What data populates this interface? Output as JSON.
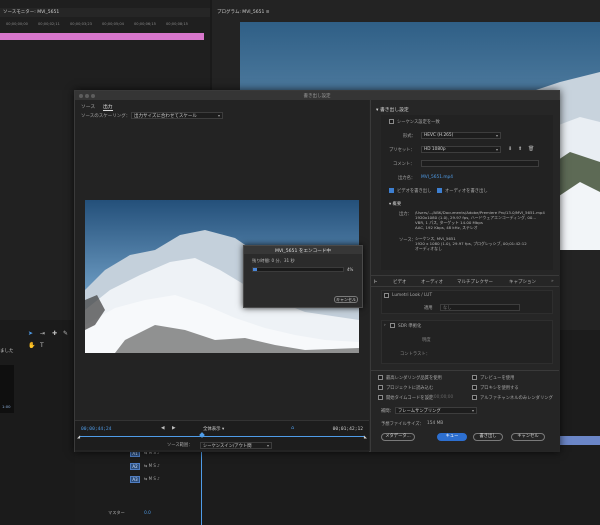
{
  "background": {
    "left_panel_title": "ソースモニター: MVI_5651",
    "left_timecodes": [
      "00;00;00;00",
      "00;00;02;11",
      "00;00;03;23",
      "00;00;05;04",
      "00;00;06;15",
      "00;00;08;15"
    ],
    "program_tab_title": "プログラム: MVI_5651 ≡",
    "left_partial_text": "ました",
    "left_partial_code": "1:00",
    "tracks": [
      {
        "label": "A1",
        "icons": "⇆  M  S  ♪"
      },
      {
        "label": "A2",
        "icons": "⇆  M  S  ♪"
      },
      {
        "label": "A3",
        "icons": "⇆  M  S  ♪"
      }
    ],
    "master_label": "マスター",
    "master_value": "0.0"
  },
  "dialog": {
    "title": "書き出し設定",
    "tabs": [
      "ソース",
      "出力"
    ],
    "active_tab": 1,
    "scaling_label": "ソースのスケーリング：",
    "scaling_value": "出力サイズに合わせてスケール",
    "encoding": {
      "title": "MVI_5651 をエンコード中",
      "remaining": "残り時間: 0 分、31 秒",
      "percent_label": "4%",
      "progress": 0.04,
      "cancel_label": "キャンセル"
    },
    "playback": {
      "current_tc": "00;00;44;24",
      "end_tc": "00;01;42;12",
      "zoom_value": "全体表示",
      "source_range_label": "ソース範囲：",
      "source_range_value": "シーケンスイン/アウト間"
    },
    "export_settings": {
      "header": "書き出し設定",
      "match_sequence_label": "シーケンス設定を一致",
      "format_label": "形式：",
      "format_value": "HEVC (H.265)",
      "preset_label": "プリセット：",
      "preset_value": "HD 1080p",
      "comment_label": "コメント：",
      "output_name_label": "出力名：",
      "output_name_value": "MVI_5651.mp4",
      "export_video_label": "ビデオを書き出し",
      "export_audio_label": "オーディオを書き出し",
      "summary_header": "概要",
      "output_label": "出力：",
      "output_lines": [
        "/Users/.../ABK/Documents/Adobe/Premiere Pro/13.0/MVI_5651.mp4",
        "1920x1080 (1.0), 29.97 fps, ハードウェアエンコーディング, 00...",
        "VBR, 1 パス, ターゲット 14.00 Mbps",
        "AAC, 192 Kbps, 48 kHz, ステレオ"
      ],
      "source_label": "ソース：",
      "source_lines": [
        "シーケンス, MVI_5651",
        "1920 x 1080 (1.0), 29.97 fps, プログレッシブ, 00;01:42:12",
        "オーディオなし"
      ]
    },
    "subtabs": [
      "ト",
      "ビデオ",
      "オーディオ",
      "マルチプレクサー",
      "キャプション"
    ],
    "lut_label": "Lumetri Look / LUT",
    "apply_label": "適用",
    "apply_value": "なし",
    "sdr_label": "SDR 準拠化",
    "brightness_label": "明度",
    "contrast_label": "コントラスト：",
    "options": {
      "max_render_label": "最高レンダリング品質を使用",
      "use_preview_label": "プレビューを使用",
      "import_project_label": "プロジェクトに読み込む",
      "use_proxy_label": "プロキシを使用する",
      "set_timecode_label": "開始タイムコードを設定",
      "timecode_value": "00;00;00;00",
      "render_alpha_label": "アルファチャンネルのみレンダリング",
      "interpolation_label": "補間：",
      "interpolation_value": "フレームサンプリング",
      "file_size_label": "予想ファイルサイズ：",
      "file_size_value": "154 MB"
    },
    "buttons": {
      "metadata": "メタデータ...",
      "queue": "キュー",
      "export": "書き出し",
      "cancel": "キャンセル"
    }
  }
}
